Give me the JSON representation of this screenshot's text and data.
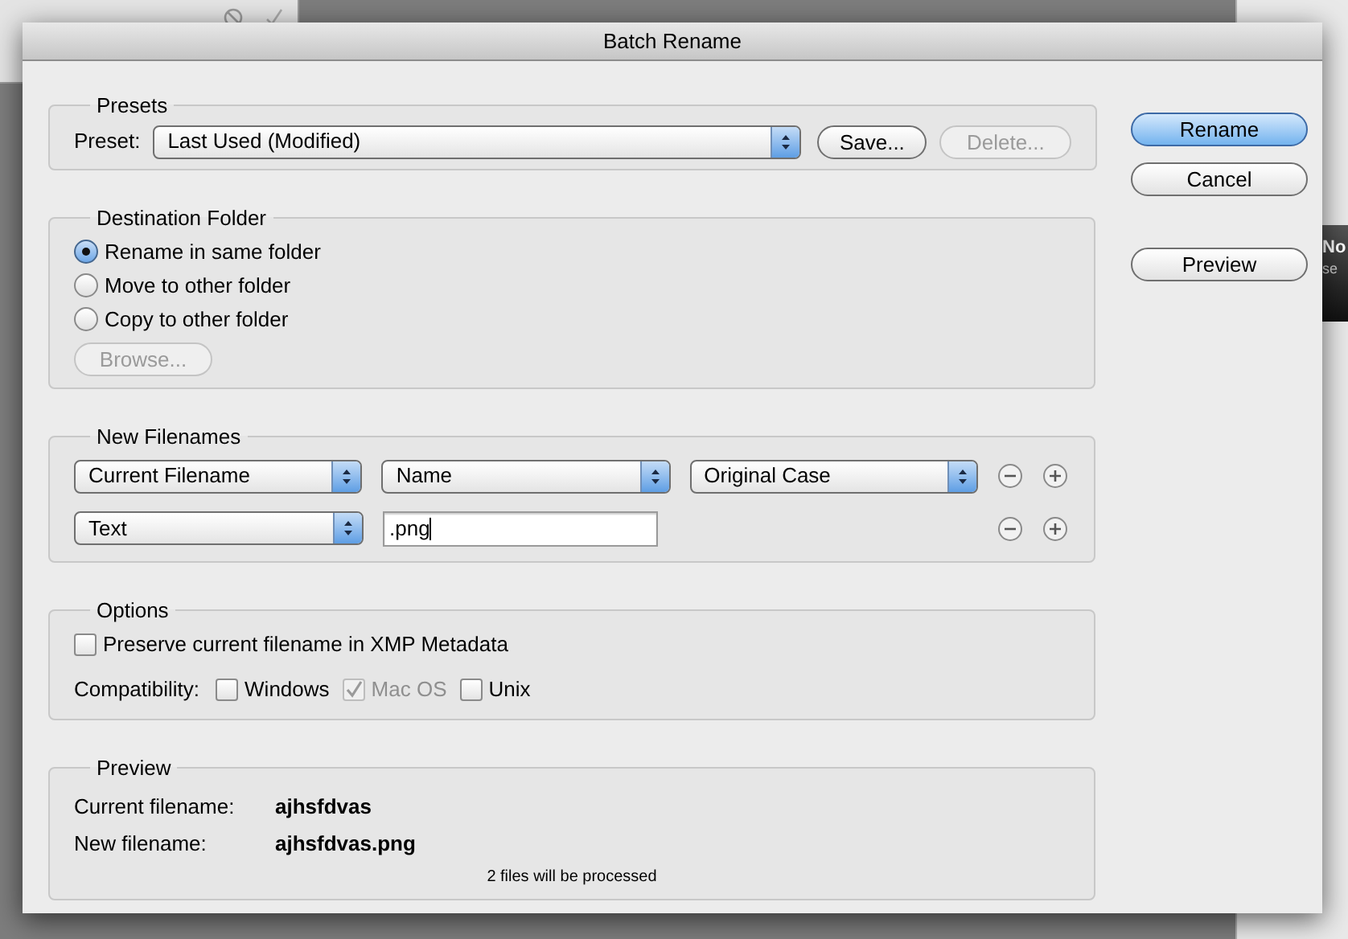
{
  "background": {
    "notification": {
      "title": "No",
      "text": "se"
    }
  },
  "window": {
    "title": "Batch Rename"
  },
  "presets": {
    "title": "Presets",
    "label": "Preset:",
    "value": "Last Used (Modified)",
    "buttons": [
      {
        "label": "Save...",
        "disabled": false
      },
      {
        "label": "Delete...",
        "disabled": true
      }
    ]
  },
  "destination": {
    "title": "Destination Folder",
    "options": [
      {
        "label": "Rename in same folder",
        "selected": true
      },
      {
        "label": "Move to other folder",
        "selected": false
      },
      {
        "label": "Copy to other folder",
        "selected": false
      }
    ],
    "browse": {
      "label": "Browse...",
      "disabled": true
    }
  },
  "new_filenames": {
    "title": "New Filenames",
    "rows": [
      {
        "items": [
          {
            "kind": "select",
            "value": "Current Filename"
          },
          {
            "kind": "select",
            "value": "Name"
          },
          {
            "kind": "select",
            "value": "Original Case"
          }
        ]
      },
      {
        "items": [
          {
            "kind": "select",
            "value": "Text"
          },
          {
            "kind": "field",
            "value": ".png"
          }
        ]
      }
    ]
  },
  "options": {
    "title": "Options",
    "preserve": {
      "label": "Preserve current filename in XMP Metadata",
      "checked": false,
      "disabled": false
    },
    "compatibility_label": "Compatibility:",
    "compatibility": [
      {
        "label": "Windows",
        "checked": false,
        "disabled": false
      },
      {
        "label": "Mac OS",
        "checked": true,
        "disabled": true
      },
      {
        "label": "Unix",
        "checked": false,
        "disabled": false
      }
    ]
  },
  "preview": {
    "title": "Preview",
    "current_label": "Current filename:",
    "current_value": "ajhsfdvas",
    "new_label": "New filename:",
    "new_value": "ajhsfdvas.png",
    "note": "2 files will be processed"
  },
  "side_buttons": [
    {
      "label": "Rename",
      "default": true
    },
    {
      "label": "Cancel",
      "default": false
    },
    {
      "label": "Preview",
      "default": false
    }
  ]
}
